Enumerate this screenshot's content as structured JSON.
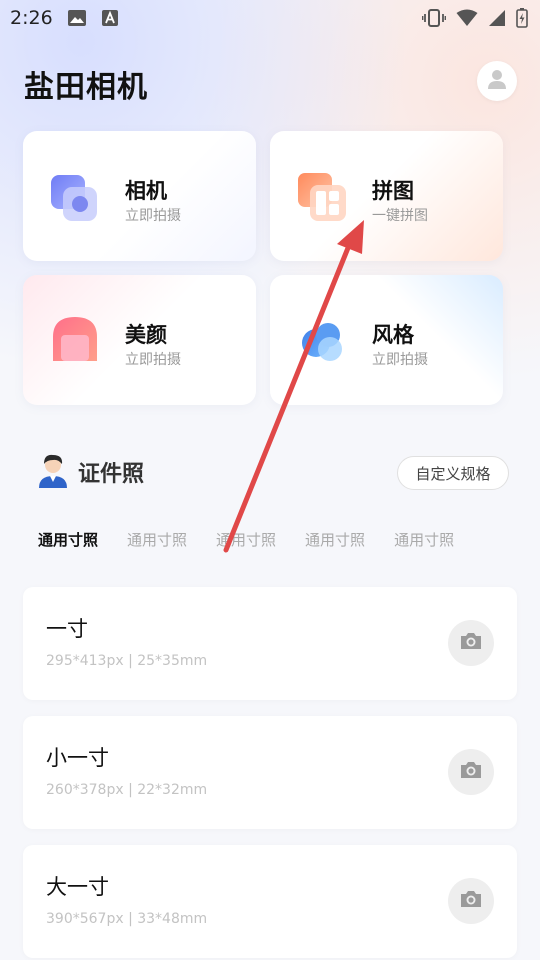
{
  "status_bar": {
    "time": "2:26",
    "icons": [
      "image-icon",
      "text-a-icon",
      "vibrate-icon",
      "wifi-icon",
      "signal-icon",
      "battery-charging-icon"
    ]
  },
  "header": {
    "title": "盐田相机",
    "avatar_icon": "user-icon"
  },
  "features": [
    {
      "title": "相机",
      "subtitle": "立即拍摄",
      "icon": "camera-feature-icon"
    },
    {
      "title": "拼图",
      "subtitle": "一键拼图",
      "icon": "collage-feature-icon"
    },
    {
      "title": "美颜",
      "subtitle": "立即拍摄",
      "icon": "beauty-feature-icon"
    },
    {
      "title": "风格",
      "subtitle": "立即拍摄",
      "icon": "style-feature-icon"
    }
  ],
  "id_photo": {
    "title": "证件照",
    "custom_button": "自定义规格",
    "tabs": [
      "通用寸照",
      "通用寸照",
      "通用寸照",
      "通用寸照",
      "通用寸照"
    ],
    "active_tab": 0,
    "sizes": [
      {
        "name": "一寸",
        "spec": "295*413px | 25*35mm"
      },
      {
        "name": "小一寸",
        "spec": "260*378px | 22*32mm"
      },
      {
        "name": "大一寸",
        "spec": "390*567px | 33*48mm"
      }
    ]
  },
  "colors": {
    "accent_arrow": "#e04848",
    "camera_gradient": [
      "#6f7cf5",
      "#a9b4ff"
    ],
    "collage_gradient": [
      "#ff8a5c",
      "#ffc4a6"
    ],
    "beauty_gradient": [
      "#ff6f8a",
      "#ffb0c0"
    ],
    "style_gradient": [
      "#3f7fe8",
      "#8fd0ff"
    ]
  }
}
